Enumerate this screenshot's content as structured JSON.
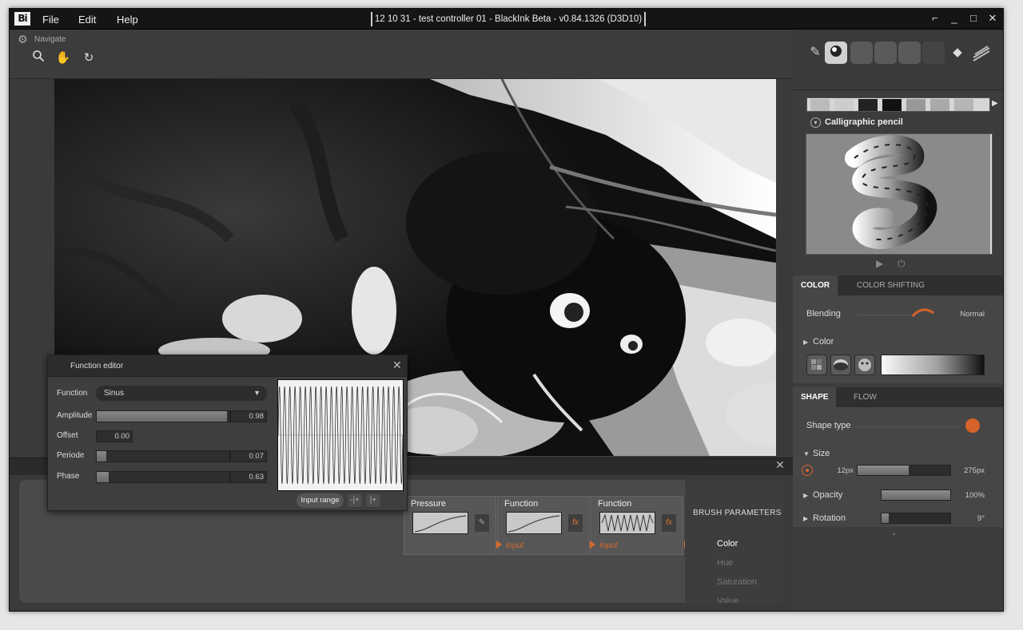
{
  "app": {
    "logo": "Bi",
    "title": "12 10 31 - test controller 01 - BlackInk Beta - v0.84.1326 (D3D10)",
    "menu": [
      "File",
      "Edit",
      "Help"
    ],
    "window_buttons": [
      "restore-down",
      "minimize",
      "maximize",
      "close"
    ]
  },
  "navigate": {
    "label": "Navigate",
    "tools": [
      "zoom",
      "pan",
      "rotate"
    ]
  },
  "function_editor": {
    "title": "Function editor",
    "function_label": "Function",
    "function_value": "Sinus",
    "params": [
      {
        "label": "Amplitude",
        "value": "0.98",
        "fraction": 0.98
      },
      {
        "label": "Offset",
        "value": "0.00"
      },
      {
        "label": "Periode",
        "value": "0.07",
        "fraction": 0.07
      },
      {
        "label": "Phase",
        "value": "0.63",
        "fraction": 0.09
      }
    ],
    "input_range_label": "Input range",
    "small_buttons": [
      "-|+",
      "|+"
    ]
  },
  "nodes": [
    {
      "title": "Pressure",
      "input": ""
    },
    {
      "title": "Function",
      "input": "Input"
    },
    {
      "title": "Function",
      "input": "Input"
    }
  ],
  "brush_parameters": {
    "title": "BRUSH PARAMETERS",
    "items": [
      "Color",
      "Hue",
      "Saturation",
      "Value"
    ],
    "active": "Color"
  },
  "right_panel": {
    "brush_name": "Calligraphic pencil",
    "color_tabs": [
      "COLOR",
      "COLOR SHIFTING"
    ],
    "blending_label": "Blending",
    "blending_value": "Normal",
    "color_label": "Color",
    "shape_tabs": [
      "SHAPE",
      "FLOW"
    ],
    "shape_type_label": "Shape type",
    "size_label": "Size",
    "size_min": "12px",
    "size_max": "275px",
    "size_fraction": 0.55,
    "opacity_label": "Opacity",
    "opacity_value": "100%",
    "opacity_fraction": 1.0,
    "rotation_label": "Rotation",
    "rotation_value": "9°",
    "rotation_fraction": 0.1
  },
  "colors": {
    "accent": "#d5632a",
    "panel": "#464646",
    "titlebar": "#151515"
  }
}
